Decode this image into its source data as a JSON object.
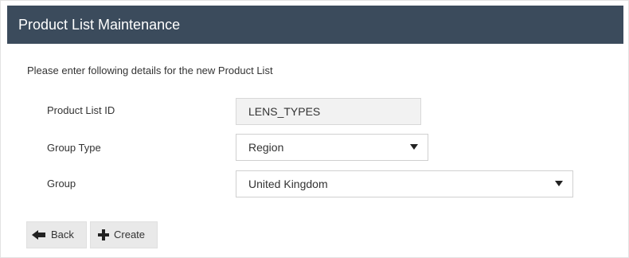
{
  "header": {
    "title": "Product List Maintenance"
  },
  "form": {
    "intro": "Please enter following details for the new Product List",
    "product_list_id": {
      "label": "Product List ID",
      "value": "LENS_TYPES"
    },
    "group_type": {
      "label": "Group Type",
      "selected": "Region"
    },
    "group": {
      "label": "Group",
      "selected": "United Kingdom"
    }
  },
  "actions": {
    "back_label": "Back",
    "create_label": "Create"
  },
  "icons": {
    "back": "arrow-left-icon",
    "create": "plus-icon",
    "dropdown": "caret-down-icon"
  },
  "colors": {
    "header_background": "#3b4b5c",
    "header_text": "#ffffff",
    "button_background": "#e9e9e9",
    "readonly_field_background": "#f2f2f2"
  }
}
